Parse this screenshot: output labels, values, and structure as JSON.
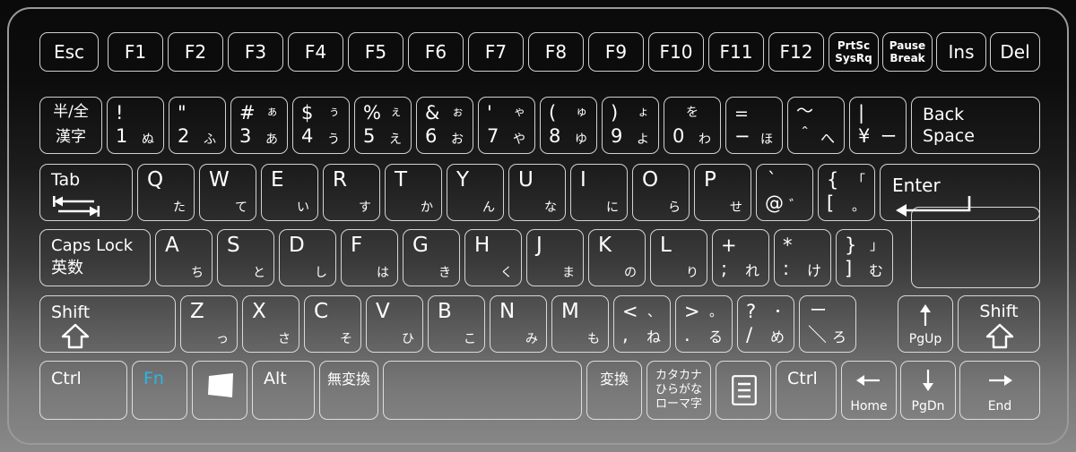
{
  "device": {
    "name": "japanese-jis-keyboard",
    "accent_color": "#29b6e8",
    "key_outline_color": "#ebebeb"
  },
  "rows": {
    "function_row": [
      {
        "name": "esc",
        "label": "Esc"
      },
      {
        "name": "f1",
        "label": "F1"
      },
      {
        "name": "f2",
        "label": "F2"
      },
      {
        "name": "f3",
        "label": "F3"
      },
      {
        "name": "f4",
        "label": "F4"
      },
      {
        "name": "f5",
        "label": "F5"
      },
      {
        "name": "f6",
        "label": "F6"
      },
      {
        "name": "f7",
        "label": "F7"
      },
      {
        "name": "f8",
        "label": "F8"
      },
      {
        "name": "f9",
        "label": "F9"
      },
      {
        "name": "f10",
        "label": "F10"
      },
      {
        "name": "f11",
        "label": "F11"
      },
      {
        "name": "f12",
        "label": "F12"
      },
      {
        "name": "prtsc",
        "label_top": "PrtSc",
        "label_bottom": "SysRq"
      },
      {
        "name": "pause",
        "label_top": "Pause",
        "label_bottom": "Break"
      },
      {
        "name": "ins",
        "label": "Ins"
      },
      {
        "name": "del",
        "label": "Del"
      }
    ],
    "number_row": [
      {
        "name": "hankaku-zenkaku",
        "line1": "半/全",
        "line2": "漢字"
      },
      {
        "name": "digit-1",
        "tl": "!",
        "tr": "",
        "bl": "1",
        "br": "ぬ"
      },
      {
        "name": "digit-2",
        "tl": "\"",
        "tr": "",
        "bl": "2",
        "br": "ふ"
      },
      {
        "name": "digit-3",
        "tl": "#",
        "tr": "ぁ",
        "bl": "3",
        "br": "あ"
      },
      {
        "name": "digit-4",
        "tl": "$",
        "tr": "ぅ",
        "bl": "4",
        "br": "う"
      },
      {
        "name": "digit-5",
        "tl": "%",
        "tr": "ぇ",
        "bl": "5",
        "br": "え"
      },
      {
        "name": "digit-6",
        "tl": "&",
        "tr": "ぉ",
        "bl": "6",
        "br": "お"
      },
      {
        "name": "digit-7",
        "tl": "'",
        "tr": "ゃ",
        "bl": "7",
        "br": "や"
      },
      {
        "name": "digit-8",
        "tl": "(",
        "tr": "ゅ",
        "bl": "8",
        "br": "ゆ"
      },
      {
        "name": "digit-9",
        "tl": ")",
        "tr": "ょ",
        "bl": "9",
        "br": "よ"
      },
      {
        "name": "digit-0",
        "tl": "",
        "tr": "を",
        "bl": "0",
        "br": "わ"
      },
      {
        "name": "minus",
        "tl": "=",
        "tr": "",
        "bl": "−",
        "br": "ほ"
      },
      {
        "name": "caret",
        "tl": "～",
        "tr": "",
        "bl": "＾",
        "br": "へ"
      },
      {
        "name": "yen",
        "tl": "|",
        "tr": "",
        "bl": "¥",
        "br": "ー"
      },
      {
        "name": "backspace",
        "label_top": "Back",
        "label_bottom": "Space"
      }
    ],
    "tab_row": [
      {
        "name": "tab",
        "label": "Tab",
        "icon": "tab-arrows-icon"
      },
      {
        "name": "key-q",
        "letter": "Q",
        "kana": "た"
      },
      {
        "name": "key-w",
        "letter": "W",
        "kana": "て"
      },
      {
        "name": "key-e",
        "letter": "E",
        "kana": "い"
      },
      {
        "name": "key-r",
        "letter": "R",
        "kana": "す"
      },
      {
        "name": "key-t",
        "letter": "T",
        "kana": "か"
      },
      {
        "name": "key-y",
        "letter": "Y",
        "kana": "ん"
      },
      {
        "name": "key-u",
        "letter": "U",
        "kana": "な"
      },
      {
        "name": "key-i",
        "letter": "I",
        "kana": "に"
      },
      {
        "name": "key-o",
        "letter": "O",
        "kana": "ら"
      },
      {
        "name": "key-p",
        "letter": "P",
        "kana": "せ"
      },
      {
        "name": "at",
        "tl": "`",
        "tr": "",
        "bl": "@",
        "br": "゛"
      },
      {
        "name": "bracket-left",
        "tl": "{",
        "tr": "「",
        "bl": "[",
        "br": "。"
      },
      {
        "name": "enter",
        "label": "Enter",
        "icon": "enter-arrow-icon"
      }
    ],
    "home_row": [
      {
        "name": "caps-lock",
        "line1": "Caps Lock",
        "line2": "英数"
      },
      {
        "name": "key-a",
        "letter": "A",
        "kana": "ち"
      },
      {
        "name": "key-s",
        "letter": "S",
        "kana": "と"
      },
      {
        "name": "key-d",
        "letter": "D",
        "kana": "し"
      },
      {
        "name": "key-f",
        "letter": "F",
        "kana": "は"
      },
      {
        "name": "key-g",
        "letter": "G",
        "kana": "き"
      },
      {
        "name": "key-h",
        "letter": "H",
        "kana": "く"
      },
      {
        "name": "key-j",
        "letter": "J",
        "kana": "ま"
      },
      {
        "name": "key-k",
        "letter": "K",
        "kana": "の"
      },
      {
        "name": "key-l",
        "letter": "L",
        "kana": "り"
      },
      {
        "name": "semicolon",
        "tl": "+",
        "tr": "",
        "bl": ";",
        "br": "れ"
      },
      {
        "name": "colon",
        "tl": "*",
        "tr": "",
        "bl": ":",
        "br": "け"
      },
      {
        "name": "bracket-right",
        "tl": "}",
        "tr": "」",
        "bl": "]",
        "br": "む"
      }
    ],
    "shift_row": [
      {
        "name": "shift-left",
        "label": "Shift",
        "icon": "shift-arrow-icon"
      },
      {
        "name": "key-z",
        "letter": "Z",
        "kana": "っ"
      },
      {
        "name": "key-x",
        "letter": "X",
        "kana": "さ"
      },
      {
        "name": "key-c",
        "letter": "C",
        "kana": "そ"
      },
      {
        "name": "key-v",
        "letter": "V",
        "kana": "ひ"
      },
      {
        "name": "key-b",
        "letter": "B",
        "kana": "こ"
      },
      {
        "name": "key-n",
        "letter": "N",
        "kana": "み"
      },
      {
        "name": "key-m",
        "letter": "M",
        "kana": "も"
      },
      {
        "name": "comma",
        "tl": "<",
        "tr": "、",
        "bl": ",",
        "br": "ね"
      },
      {
        "name": "period",
        "tl": ">",
        "tr": "。",
        "bl": ".",
        "br": "る"
      },
      {
        "name": "slash",
        "tl": "?",
        "tr": "・",
        "bl": "/",
        "br": "め"
      },
      {
        "name": "backslash-ro",
        "tl": "ー",
        "tr": "",
        "bl": "＼",
        "br": "ろ"
      },
      {
        "name": "arrow-up",
        "arrow": "↑",
        "label": "PgUp"
      },
      {
        "name": "shift-right",
        "label": "Shift",
        "icon": "shift-arrow-icon"
      }
    ],
    "bottom_row": [
      {
        "name": "ctrl-left",
        "label": "Ctrl"
      },
      {
        "name": "fn",
        "label": "Fn",
        "color": "#29b6e8"
      },
      {
        "name": "windows",
        "label": "",
        "icon": "windows-logo-icon"
      },
      {
        "name": "alt-left",
        "label": "Alt"
      },
      {
        "name": "muhenkan",
        "label": "無変換"
      },
      {
        "name": "space",
        "label": ""
      },
      {
        "name": "henkan",
        "label": "変換"
      },
      {
        "name": "katakana-hiragana",
        "line1": "カタカナ",
        "line2": "ひらがな",
        "line3": "ローマ字"
      },
      {
        "name": "menu",
        "label": "",
        "icon": "application-menu-icon"
      },
      {
        "name": "ctrl-right",
        "label": "Ctrl"
      },
      {
        "name": "arrow-left",
        "arrow": "←",
        "label": "Home"
      },
      {
        "name": "arrow-down",
        "arrow": "↓",
        "label": "PgDn"
      },
      {
        "name": "arrow-right",
        "arrow": "→",
        "label": "End"
      }
    ]
  }
}
